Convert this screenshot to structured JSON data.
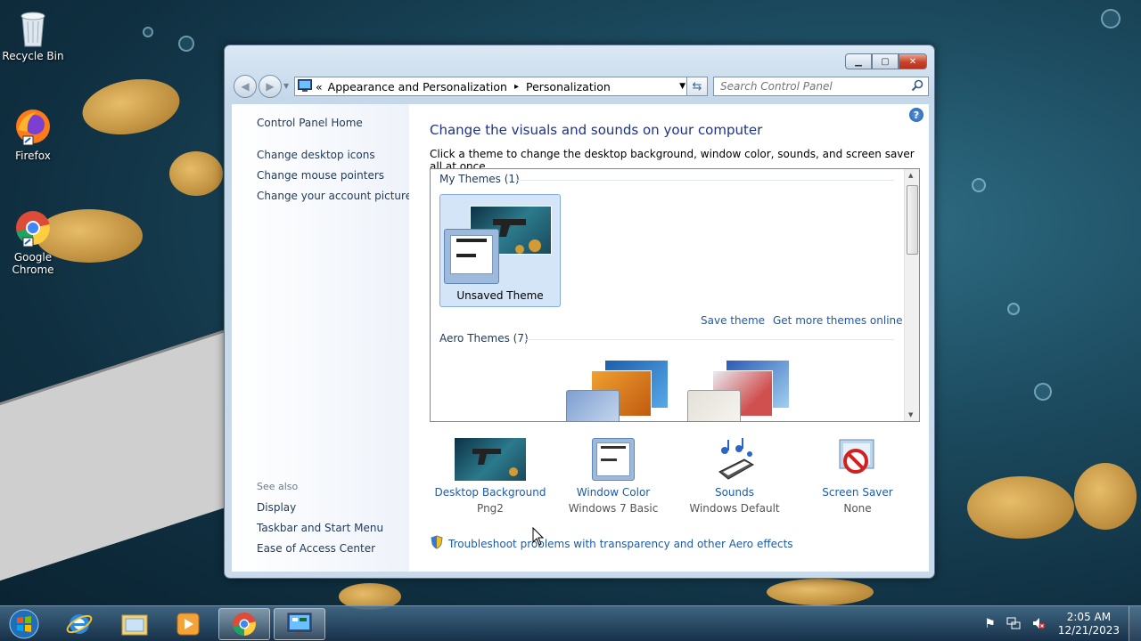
{
  "desktop": {
    "icons": [
      {
        "label": "Recycle Bin",
        "icon": "recycle-bin-icon"
      },
      {
        "label": "Firefox",
        "icon": "firefox-icon"
      },
      {
        "label": "Google Chrome",
        "icon": "chrome-icon"
      }
    ]
  },
  "window": {
    "breadcrumb": {
      "root_sep": "«",
      "part1": "Appearance and Personalization",
      "sep": "▸",
      "part2": "Personalization"
    },
    "search_placeholder": "Search Control Panel",
    "left_nav": {
      "home": "Control Panel Home",
      "links": [
        "Change desktop icons",
        "Change mouse pointers",
        "Change your account picture"
      ],
      "see_also_heading": "See also",
      "see_also": [
        "Display",
        "Taskbar and Start Menu",
        "Ease of Access Center"
      ]
    },
    "main": {
      "title": "Change the visuals and sounds on your computer",
      "subtitle": "Click a theme to change the desktop background, window color, sounds, and screen saver all at once.",
      "my_themes_heading": "My Themes (1)",
      "unsaved_theme_label": "Unsaved Theme",
      "save_theme": "Save theme",
      "get_more_themes": "Get more themes online",
      "aero_themes_heading": "Aero Themes (7)"
    },
    "settings": [
      {
        "label": "Desktop Background",
        "value": "Png2",
        "icon": "desktop-background-icon"
      },
      {
        "label": "Window Color",
        "value": "Windows 7 Basic",
        "icon": "window-color-icon"
      },
      {
        "label": "Sounds",
        "value": "Windows Default",
        "icon": "sounds-icon"
      },
      {
        "label": "Screen Saver",
        "value": "None",
        "icon": "screen-saver-icon"
      }
    ],
    "troubleshoot_link": "Troubleshoot problems with transparency and other Aero effects"
  },
  "taskbar": {
    "items": [
      "start-orb",
      "internet-explorer",
      "windows-explorer",
      "media-player",
      "google-chrome",
      "control-panel"
    ],
    "time": "2:05 AM",
    "date": "12/21/2023"
  },
  "colors": {
    "link": "#1e5aa8",
    "title": "#1e3287",
    "nav_text": "#1e395b"
  }
}
